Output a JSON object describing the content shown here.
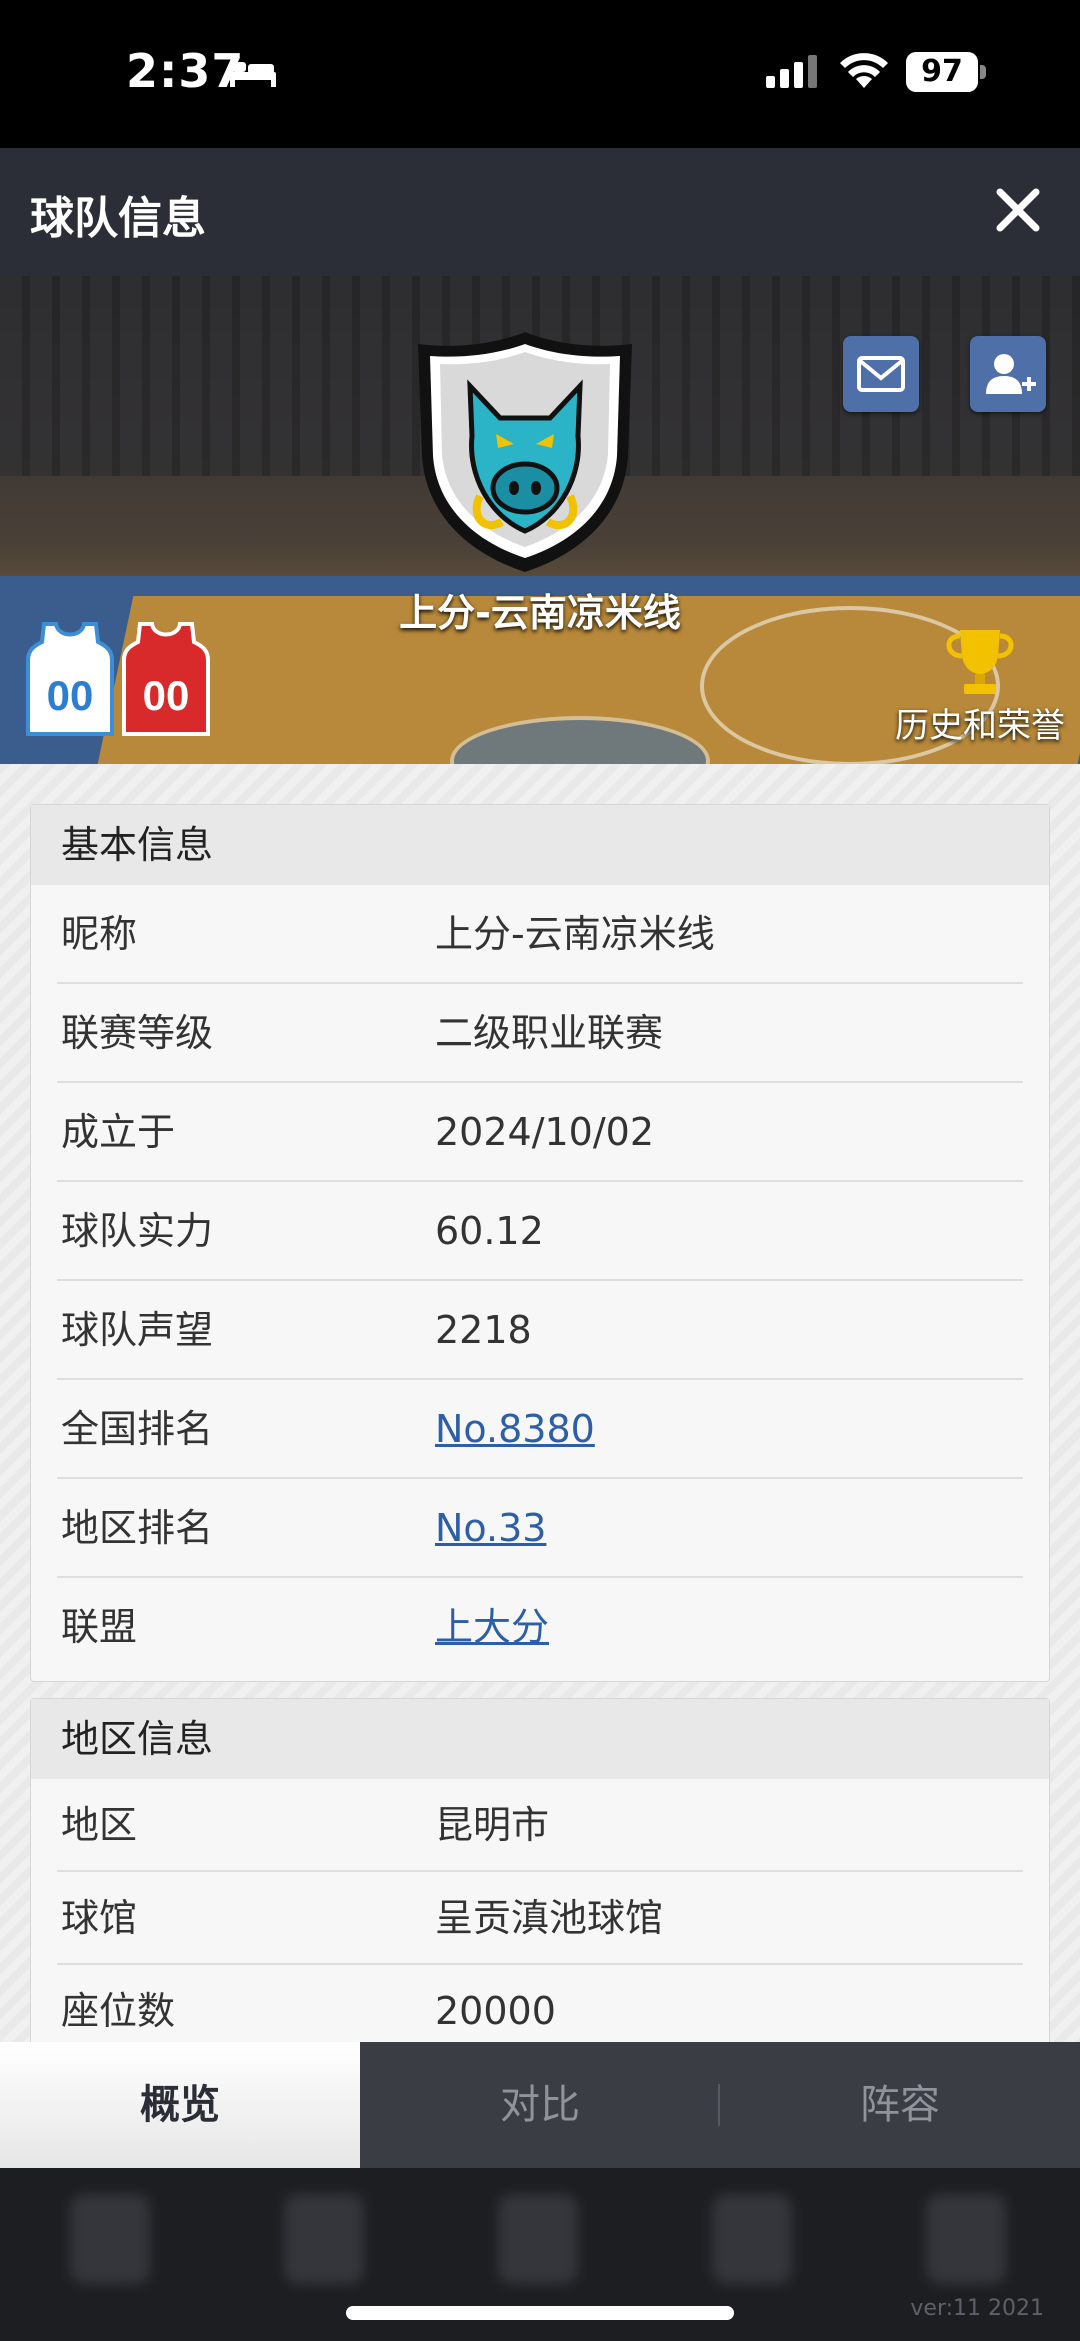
{
  "status_bar": {
    "time": "2:37",
    "battery": "97"
  },
  "header": {
    "title": "球队信息"
  },
  "banner": {
    "team_name": "上分-云南凉米线",
    "jersey_home_number": "00",
    "jersey_away_number": "00",
    "honors_label": "历史和荣誉"
  },
  "basic_info": {
    "heading": "基本信息",
    "rows": [
      {
        "label": "昵称",
        "value": "上分-云南凉米线"
      },
      {
        "label": "联赛等级",
        "value": "二级职业联赛"
      },
      {
        "label": "成立于",
        "value": "2024/10/02"
      },
      {
        "label": "球队实力",
        "value": "60.12"
      },
      {
        "label": "球队声望",
        "value": "2218"
      },
      {
        "label": "全国排名",
        "value": "No.8380"
      },
      {
        "label": "地区排名",
        "value": "No.33"
      },
      {
        "label": "联盟",
        "value": "上大分"
      }
    ]
  },
  "region_info": {
    "heading": "地区信息",
    "rows": [
      {
        "label": "地区",
        "value": "昆明市"
      },
      {
        "label": "球馆",
        "value": "呈贡滇池球馆"
      },
      {
        "label": "座位数",
        "value": "20000"
      }
    ]
  },
  "tabs": [
    {
      "label": "概览",
      "active": true
    },
    {
      "label": "对比",
      "active": false
    },
    {
      "label": "阵容",
      "active": false
    }
  ],
  "footer": {
    "version": "ver:11  2021"
  },
  "colors": {
    "accent_link": "#2d5fa8",
    "header_bg": "#2b2e36",
    "button_blue": "#4f6fa8"
  }
}
